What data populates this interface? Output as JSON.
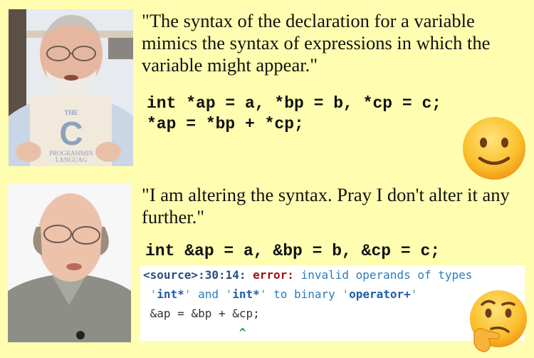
{
  "panels": [
    {
      "photo": {
        "description": "Bearded man with glasses holding a book",
        "book_title_lines": [
          "THE",
          "C",
          "PROGRAMMIN",
          "LANGUAG"
        ]
      },
      "quote": "\"The syntax of the declaration for a variable mimics the syntax of expressions in which the variable might appear.\"",
      "code_lines": [
        "int *ap = a, *bp = b, *cp = c;",
        "*ap = *bp + *cp;"
      ],
      "emoji": "slightly-smiling-face"
    },
    {
      "photo": {
        "description": "Balding man with glasses speaking"
      },
      "quote": "\"I am altering the syntax. Pray I don't alter it any further.\"",
      "code_lines": [
        "int &ap = a, &bp = b, &cp = c;"
      ],
      "compiler_output": {
        "location": "<source>:30:14:",
        "severity": "error:",
        "message": "invalid operands of types",
        "line2": {
          "type1": "int*",
          "conj": "and",
          "type2": "int*",
          "mid": "to binary",
          "op": "operator+"
        },
        "echo": "&ap = &bp + &cp;",
        "caret": "^"
      },
      "emoji": "thinking-face"
    }
  ]
}
